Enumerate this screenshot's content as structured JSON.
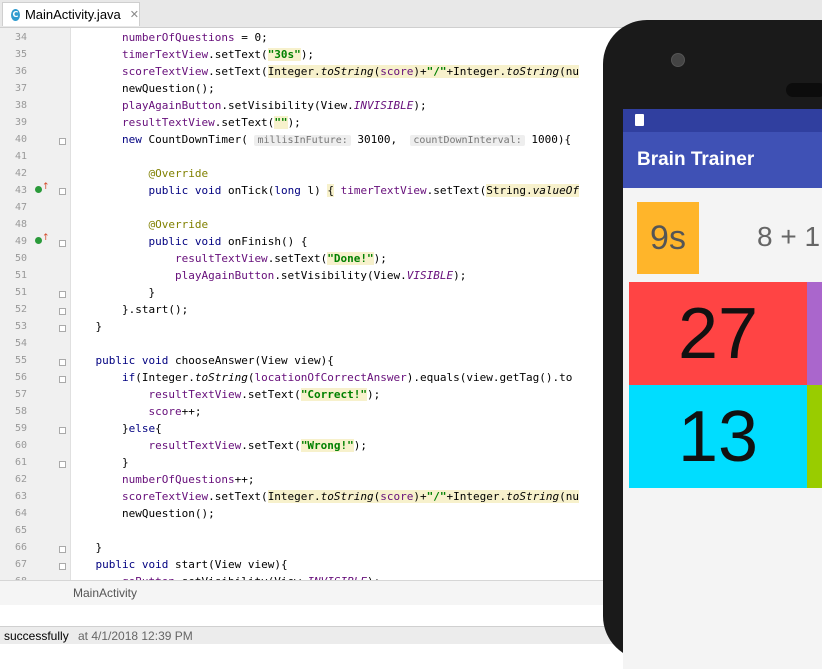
{
  "tab": {
    "icon": "C",
    "name": "MainActivity.java",
    "close": "✕"
  },
  "code_lines": [
    {
      "n": "34",
      "parts": [
        {
          "t": "        numberOfQuestions",
          "c": "fld"
        },
        {
          "t": " = 0;"
        }
      ]
    },
    {
      "n": "35",
      "parts": [
        {
          "t": "        timerTextView",
          "c": "fld"
        },
        {
          "t": ".setText("
        },
        {
          "t": "\"30s\"",
          "c": "str"
        },
        {
          "t": ");"
        }
      ]
    },
    {
      "n": "36",
      "parts": [
        {
          "t": "        scoreTextView",
          "c": "fld"
        },
        {
          "t": ".setText("
        },
        {
          "t": "Integer.",
          "c": "hl"
        },
        {
          "t": "toString",
          "c": "it hl"
        },
        {
          "t": "(",
          "c": "hl"
        },
        {
          "t": "score",
          "c": "fld hl"
        },
        {
          "t": ")+",
          "c": "hl"
        },
        {
          "t": "\"/\"",
          "c": "str"
        },
        {
          "t": "+Integer.",
          "c": "hl"
        },
        {
          "t": "toString",
          "c": "it hl"
        },
        {
          "t": "(nu",
          "c": "hl"
        }
      ]
    },
    {
      "n": "37",
      "parts": [
        {
          "t": "        newQuestion();"
        }
      ]
    },
    {
      "n": "38",
      "parts": [
        {
          "t": "        playAgainButton",
          "c": "fld"
        },
        {
          "t": ".setVisibility(View."
        },
        {
          "t": "INVISIBLE",
          "c": "fld it"
        },
        {
          "t": ");"
        }
      ]
    },
    {
      "n": "39",
      "parts": [
        {
          "t": "        resultTextView",
          "c": "fld"
        },
        {
          "t": ".setText("
        },
        {
          "t": "\"\"",
          "c": "str"
        },
        {
          "t": ");"
        }
      ]
    },
    {
      "n": "40",
      "parts": [
        {
          "t": "        "
        },
        {
          "t": "new",
          "c": "kw"
        },
        {
          "t": " CountDownTimer( "
        },
        {
          "t": "millisInFuture:",
          "c": "hint"
        },
        {
          "t": " 30100,  "
        },
        {
          "t": "countDownInterval:",
          "c": "hint"
        },
        {
          "t": " 1000){"
        }
      ]
    },
    {
      "n": "41",
      "parts": [
        {
          "t": ""
        }
      ]
    },
    {
      "n": "42",
      "parts": [
        {
          "t": "            "
        },
        {
          "t": "@Override",
          "c": "ann"
        }
      ]
    },
    {
      "n": "43",
      "parts": [
        {
          "t": "            "
        },
        {
          "t": "public void",
          "c": "kw"
        },
        {
          "t": " onTick("
        },
        {
          "t": "long",
          "c": "kw"
        },
        {
          "t": " l) "
        },
        {
          "t": "{",
          "c": "hl"
        },
        {
          "t": " "
        },
        {
          "t": "timerTextView",
          "c": "fld"
        },
        {
          "t": ".setText("
        },
        {
          "t": "String.",
          "c": "hl"
        },
        {
          "t": "valueOf",
          "c": "it hl"
        }
      ]
    },
    {
      "n": "47",
      "parts": [
        {
          "t": ""
        }
      ]
    },
    {
      "n": "48",
      "parts": [
        {
          "t": "            "
        },
        {
          "t": "@Override",
          "c": "ann"
        }
      ]
    },
    {
      "n": "49",
      "parts": [
        {
          "t": "            "
        },
        {
          "t": "public void",
          "c": "kw"
        },
        {
          "t": " onFinish() {"
        }
      ]
    },
    {
      "n": "50",
      "parts": [
        {
          "t": "                "
        },
        {
          "t": "resultTextView",
          "c": "fld"
        },
        {
          "t": ".setText("
        },
        {
          "t": "\"Done!\"",
          "c": "str"
        },
        {
          "t": ");"
        }
      ]
    },
    {
      "n": "51",
      "parts": [
        {
          "t": "                "
        },
        {
          "t": "playAgainButton",
          "c": "fld"
        },
        {
          "t": ".setVisibility(View."
        },
        {
          "t": "VISIBLE",
          "c": "fld it"
        },
        {
          "t": ");"
        }
      ]
    },
    {
      "n": "51",
      "parts": [
        {
          "t": "            }"
        }
      ]
    },
    {
      "n": "52",
      "parts": [
        {
          "t": "        }.start();"
        }
      ]
    },
    {
      "n": "53",
      "parts": [
        {
          "t": "    }"
        }
      ]
    },
    {
      "n": "54",
      "parts": [
        {
          "t": ""
        }
      ]
    },
    {
      "n": "55",
      "parts": [
        {
          "t": "    "
        },
        {
          "t": "public void",
          "c": "kw"
        },
        {
          "t": " chooseAnswer(View view){"
        }
      ]
    },
    {
      "n": "56",
      "parts": [
        {
          "t": "        "
        },
        {
          "t": "if",
          "c": "kw"
        },
        {
          "t": "(Integer."
        },
        {
          "t": "toString",
          "c": "it"
        },
        {
          "t": "("
        },
        {
          "t": "locationOfCorrectAnswer",
          "c": "fld"
        },
        {
          "t": ").equals(view.getTag().to"
        }
      ]
    },
    {
      "n": "57",
      "parts": [
        {
          "t": "            "
        },
        {
          "t": "resultTextView",
          "c": "fld"
        },
        {
          "t": ".setText("
        },
        {
          "t": "\"Correct!\"",
          "c": "str"
        },
        {
          "t": ");"
        }
      ]
    },
    {
      "n": "58",
      "parts": [
        {
          "t": "            "
        },
        {
          "t": "score",
          "c": "fld"
        },
        {
          "t": "++;"
        }
      ]
    },
    {
      "n": "59",
      "parts": [
        {
          "t": "        }"
        },
        {
          "t": "else",
          "c": "kw"
        },
        {
          "t": "{"
        }
      ]
    },
    {
      "n": "60",
      "parts": [
        {
          "t": "            "
        },
        {
          "t": "resultTextView",
          "c": "fld"
        },
        {
          "t": ".setText("
        },
        {
          "t": "\"Wrong!\"",
          "c": "str"
        },
        {
          "t": ");"
        }
      ]
    },
    {
      "n": "61",
      "parts": [
        {
          "t": "        }"
        }
      ]
    },
    {
      "n": "62",
      "parts": [
        {
          "t": "        "
        },
        {
          "t": "numberOfQuestions",
          "c": "fld"
        },
        {
          "t": "++;"
        }
      ]
    },
    {
      "n": "63",
      "parts": [
        {
          "t": "        "
        },
        {
          "t": "scoreTextView",
          "c": "fld"
        },
        {
          "t": ".setText("
        },
        {
          "t": "Integer.",
          "c": "hl"
        },
        {
          "t": "toString",
          "c": "it hl"
        },
        {
          "t": "(",
          "c": "hl"
        },
        {
          "t": "score",
          "c": "fld hl"
        },
        {
          "t": ")+",
          "c": "hl"
        },
        {
          "t": "\"/\"",
          "c": "str"
        },
        {
          "t": "+Integer.",
          "c": "hl"
        },
        {
          "t": "toString",
          "c": "it hl"
        },
        {
          "t": "(nu",
          "c": "hl"
        }
      ]
    },
    {
      "n": "64",
      "parts": [
        {
          "t": "        newQuestion();"
        }
      ]
    },
    {
      "n": "65",
      "parts": [
        {
          "t": ""
        }
      ]
    },
    {
      "n": "66",
      "parts": [
        {
          "t": "    }"
        }
      ]
    },
    {
      "n": "67",
      "parts": [
        {
          "t": "    "
        },
        {
          "t": "public void",
          "c": "kw"
        },
        {
          "t": " start(View view){"
        }
      ]
    },
    {
      "n": "68",
      "parts": [
        {
          "t": "        "
        },
        {
          "t": "goButton",
          "c": "fld"
        },
        {
          "t": ".setVisibility(View."
        },
        {
          "t": "INVISIBLE",
          "c": "fld it"
        },
        {
          "t": ");"
        }
      ]
    }
  ],
  "breadcrumb": "MainActivity",
  "status": {
    "text": "successfully",
    "time": "at 4/1/2018 12:39 PM"
  },
  "phone": {
    "title": "Brain Trainer",
    "timer": "9s",
    "question": "8 + 1",
    "answers": [
      {
        "value": "27",
        "color": "#ff4444"
      },
      {
        "value": "",
        "color": "#aa66cc"
      },
      {
        "value": "13",
        "color": "#00ddff"
      },
      {
        "value": "",
        "color": "#99cc00"
      }
    ]
  }
}
